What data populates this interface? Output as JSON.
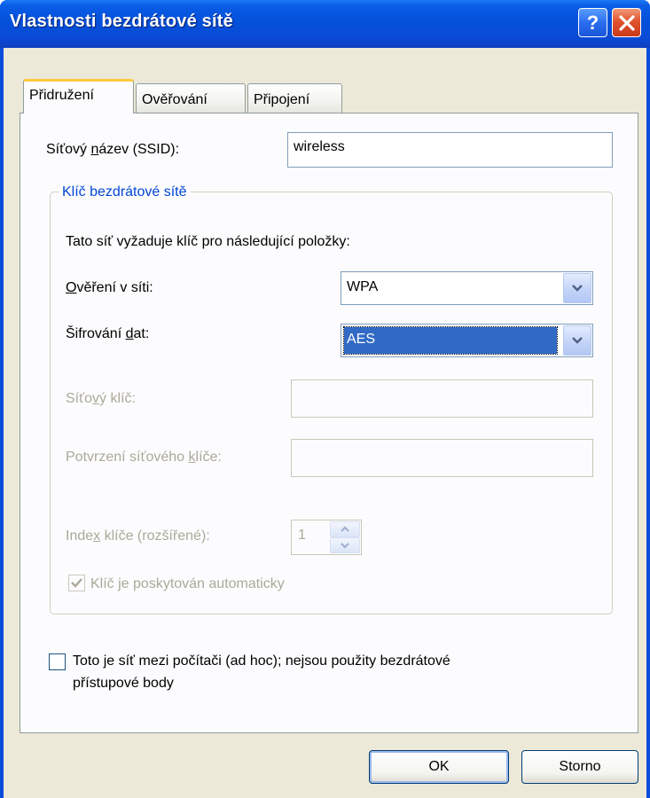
{
  "window": {
    "title": "Vlastnosti bezdrátové sítě",
    "help_label": "?"
  },
  "tabs": [
    {
      "label": "Přidružení",
      "active": true
    },
    {
      "label": "Ověřování",
      "active": false
    },
    {
      "label": "Připojení",
      "active": false
    }
  ],
  "ssid": {
    "label_pre": "Síťový ",
    "label_underlined": "n",
    "label_post": "ázev (SSID):",
    "value": "wireless"
  },
  "key_group": {
    "legend": "Klíč bezdrátové sítě",
    "info": "Tato síť vyžaduje klíč pro následující položky:",
    "auth": {
      "label_underlined": "O",
      "label_post": "věření v síti:",
      "value": "WPA"
    },
    "encryption": {
      "label_pre": "Šifrování ",
      "label_underlined": "d",
      "label_post": "at:",
      "value": "AES"
    },
    "network_key": {
      "label_pre": "Síťo",
      "label_underlined": "v",
      "label_post": "ý klíč:",
      "value": ""
    },
    "confirm_key": {
      "label_pre": "Potvrzení síťového ",
      "label_underlined": "k",
      "label_post": "líče:",
      "value": ""
    },
    "key_index": {
      "label_pre": "Inde",
      "label_underlined": "x",
      "label_post": " klíče (rozšířené):",
      "value": "1"
    },
    "auto_key": {
      "label": "Klíč je poskytován automaticky",
      "checked": true
    }
  },
  "adhoc": {
    "line1_pre": "Toto ",
    "line1_underlined": "j",
    "line1_post": "e síť mezi počítači (ad hoc); nejsou použity bezdrátové",
    "line2": "přístupové body",
    "checked": false
  },
  "buttons": {
    "ok": "OK",
    "cancel": "Storno"
  },
  "colors": {
    "title_bar": "#0451da",
    "accent_tab": "#ffc83c",
    "group_legend": "#0046d5",
    "selection": "#316ac5"
  }
}
